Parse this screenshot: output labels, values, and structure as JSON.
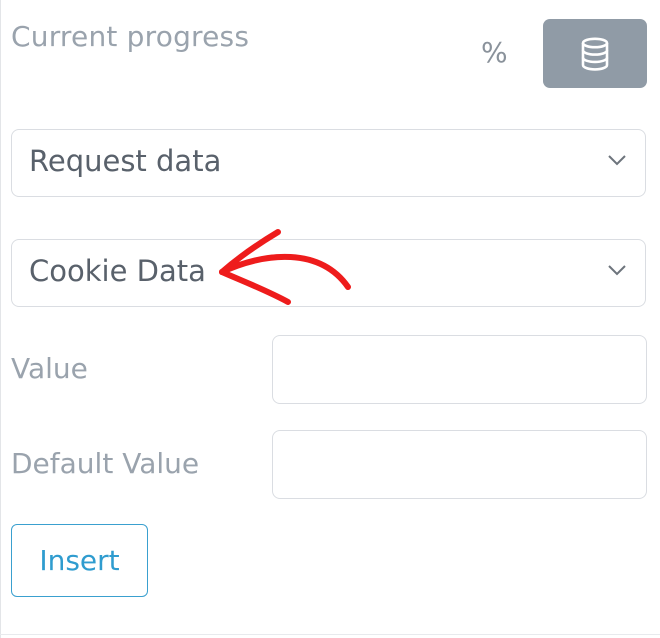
{
  "header": {
    "title": "Current progress",
    "unit": "%",
    "database_button_icon": "database-icon"
  },
  "selects": {
    "request": {
      "value": "Request data",
      "icon": "chevron-down-icon"
    },
    "cookie": {
      "value": "Cookie Data",
      "icon": "chevron-down-icon"
    }
  },
  "fields": {
    "value": {
      "label": "Value",
      "value": ""
    },
    "default_value": {
      "label": "Default Value",
      "value": ""
    }
  },
  "actions": {
    "insert_label": "Insert"
  },
  "annotation": {
    "arrow_color": "#ee1c1c"
  },
  "colors": {
    "accent": "#2f9ccf",
    "button_bg": "#909ba6"
  }
}
